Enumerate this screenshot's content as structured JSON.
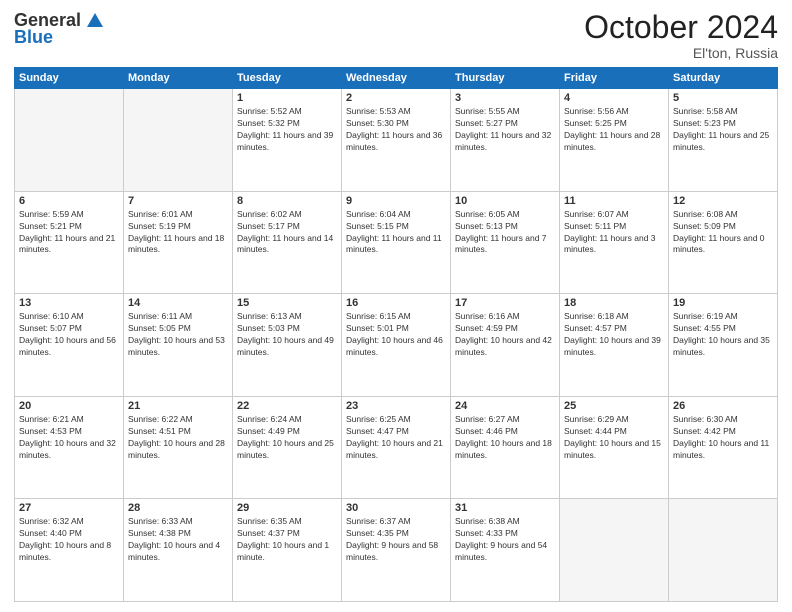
{
  "header": {
    "logo_general": "General",
    "logo_blue": "Blue",
    "month": "October 2024",
    "location": "El'ton, Russia"
  },
  "days_of_week": [
    "Sunday",
    "Monday",
    "Tuesday",
    "Wednesday",
    "Thursday",
    "Friday",
    "Saturday"
  ],
  "weeks": [
    [
      {
        "day": "",
        "info": ""
      },
      {
        "day": "",
        "info": ""
      },
      {
        "day": "1",
        "info": "Sunrise: 5:52 AM\nSunset: 5:32 PM\nDaylight: 11 hours and 39 minutes."
      },
      {
        "day": "2",
        "info": "Sunrise: 5:53 AM\nSunset: 5:30 PM\nDaylight: 11 hours and 36 minutes."
      },
      {
        "day": "3",
        "info": "Sunrise: 5:55 AM\nSunset: 5:27 PM\nDaylight: 11 hours and 32 minutes."
      },
      {
        "day": "4",
        "info": "Sunrise: 5:56 AM\nSunset: 5:25 PM\nDaylight: 11 hours and 28 minutes."
      },
      {
        "day": "5",
        "info": "Sunrise: 5:58 AM\nSunset: 5:23 PM\nDaylight: 11 hours and 25 minutes."
      }
    ],
    [
      {
        "day": "6",
        "info": "Sunrise: 5:59 AM\nSunset: 5:21 PM\nDaylight: 11 hours and 21 minutes."
      },
      {
        "day": "7",
        "info": "Sunrise: 6:01 AM\nSunset: 5:19 PM\nDaylight: 11 hours and 18 minutes."
      },
      {
        "day": "8",
        "info": "Sunrise: 6:02 AM\nSunset: 5:17 PM\nDaylight: 11 hours and 14 minutes."
      },
      {
        "day": "9",
        "info": "Sunrise: 6:04 AM\nSunset: 5:15 PM\nDaylight: 11 hours and 11 minutes."
      },
      {
        "day": "10",
        "info": "Sunrise: 6:05 AM\nSunset: 5:13 PM\nDaylight: 11 hours and 7 minutes."
      },
      {
        "day": "11",
        "info": "Sunrise: 6:07 AM\nSunset: 5:11 PM\nDaylight: 11 hours and 3 minutes."
      },
      {
        "day": "12",
        "info": "Sunrise: 6:08 AM\nSunset: 5:09 PM\nDaylight: 11 hours and 0 minutes."
      }
    ],
    [
      {
        "day": "13",
        "info": "Sunrise: 6:10 AM\nSunset: 5:07 PM\nDaylight: 10 hours and 56 minutes."
      },
      {
        "day": "14",
        "info": "Sunrise: 6:11 AM\nSunset: 5:05 PM\nDaylight: 10 hours and 53 minutes."
      },
      {
        "day": "15",
        "info": "Sunrise: 6:13 AM\nSunset: 5:03 PM\nDaylight: 10 hours and 49 minutes."
      },
      {
        "day": "16",
        "info": "Sunrise: 6:15 AM\nSunset: 5:01 PM\nDaylight: 10 hours and 46 minutes."
      },
      {
        "day": "17",
        "info": "Sunrise: 6:16 AM\nSunset: 4:59 PM\nDaylight: 10 hours and 42 minutes."
      },
      {
        "day": "18",
        "info": "Sunrise: 6:18 AM\nSunset: 4:57 PM\nDaylight: 10 hours and 39 minutes."
      },
      {
        "day": "19",
        "info": "Sunrise: 6:19 AM\nSunset: 4:55 PM\nDaylight: 10 hours and 35 minutes."
      }
    ],
    [
      {
        "day": "20",
        "info": "Sunrise: 6:21 AM\nSunset: 4:53 PM\nDaylight: 10 hours and 32 minutes."
      },
      {
        "day": "21",
        "info": "Sunrise: 6:22 AM\nSunset: 4:51 PM\nDaylight: 10 hours and 28 minutes."
      },
      {
        "day": "22",
        "info": "Sunrise: 6:24 AM\nSunset: 4:49 PM\nDaylight: 10 hours and 25 minutes."
      },
      {
        "day": "23",
        "info": "Sunrise: 6:25 AM\nSunset: 4:47 PM\nDaylight: 10 hours and 21 minutes."
      },
      {
        "day": "24",
        "info": "Sunrise: 6:27 AM\nSunset: 4:46 PM\nDaylight: 10 hours and 18 minutes."
      },
      {
        "day": "25",
        "info": "Sunrise: 6:29 AM\nSunset: 4:44 PM\nDaylight: 10 hours and 15 minutes."
      },
      {
        "day": "26",
        "info": "Sunrise: 6:30 AM\nSunset: 4:42 PM\nDaylight: 10 hours and 11 minutes."
      }
    ],
    [
      {
        "day": "27",
        "info": "Sunrise: 6:32 AM\nSunset: 4:40 PM\nDaylight: 10 hours and 8 minutes."
      },
      {
        "day": "28",
        "info": "Sunrise: 6:33 AM\nSunset: 4:38 PM\nDaylight: 10 hours and 4 minutes."
      },
      {
        "day": "29",
        "info": "Sunrise: 6:35 AM\nSunset: 4:37 PM\nDaylight: 10 hours and 1 minute."
      },
      {
        "day": "30",
        "info": "Sunrise: 6:37 AM\nSunset: 4:35 PM\nDaylight: 9 hours and 58 minutes."
      },
      {
        "day": "31",
        "info": "Sunrise: 6:38 AM\nSunset: 4:33 PM\nDaylight: 9 hours and 54 minutes."
      },
      {
        "day": "",
        "info": ""
      },
      {
        "day": "",
        "info": ""
      }
    ]
  ]
}
